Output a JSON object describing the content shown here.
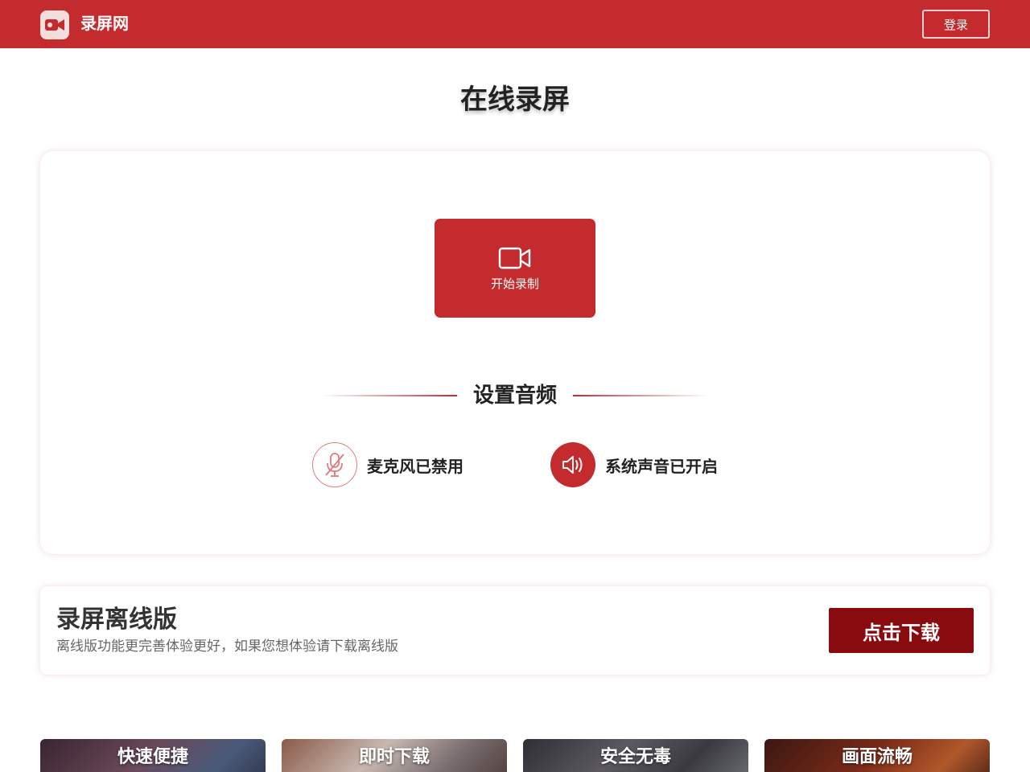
{
  "header": {
    "site_name": "录屏网",
    "login_label": "登录",
    "logo_icon": "video-camera-icon",
    "bg_color": "#c42b2e"
  },
  "page_title": "在线录屏",
  "recorder": {
    "start_label": "开始录制",
    "start_icon": "video-camera-icon",
    "audio_heading": "设置音频",
    "mic": {
      "label": "麦克风已禁用",
      "icon": "microphone-muted-icon",
      "enabled": false
    },
    "system_audio": {
      "label": "系统声音已开启",
      "icon": "speaker-icon",
      "enabled": true
    }
  },
  "offline": {
    "title": "录屏离线版",
    "description": "离线版功能更完善体验更好，如果您想体验请下载离线版",
    "download_label": "点击下载",
    "button_color": "#8a0b0f"
  },
  "features": [
    {
      "label": "快速便捷"
    },
    {
      "label": "即时下载"
    },
    {
      "label": "安全无毒"
    },
    {
      "label": "画面流畅"
    }
  ],
  "colors": {
    "accent": "#c42b2e",
    "dark_accent": "#8a0b0f"
  }
}
